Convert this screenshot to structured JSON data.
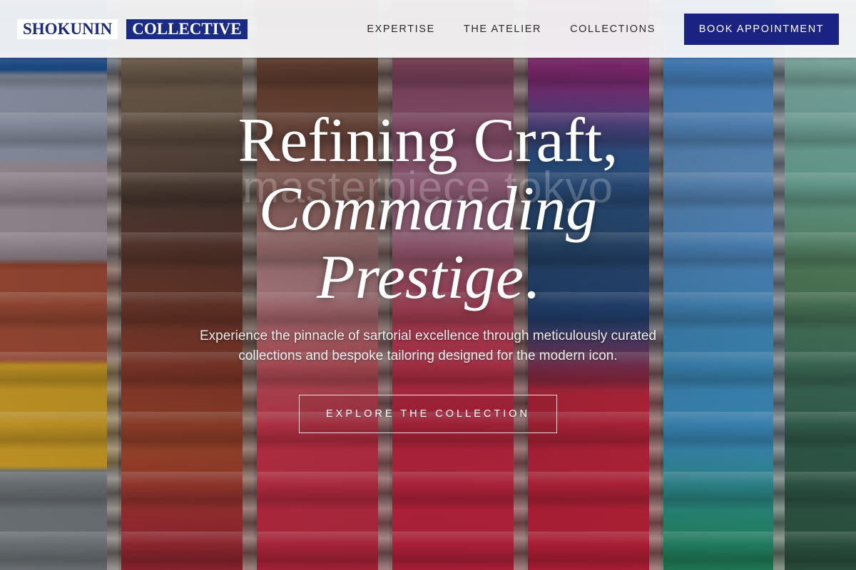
{
  "brand": {
    "name_part_a": "SHOKUNIN",
    "name_part_b": "COLLECTIVE"
  },
  "nav": {
    "links": [
      "EXPERTISE",
      "THE ATELIER",
      "COLLECTIONS"
    ],
    "cta_label": "BOOK APPOINTMENT"
  },
  "hero": {
    "headline_line_1": "Refining Craft,",
    "headline_line_2": "Commanding",
    "headline_line_3_em": "Prestige",
    "headline_line_3_end": ".",
    "watermark": "masterpiece tokyo",
    "subtitle": "Experience the pinnacle of sartorial excellence through meticulously curated collections and bespoke tailoring designed for the modern icon.",
    "cta_label": "EXPLORE THE COLLECTION"
  },
  "colors": {
    "brand_navy": "#1b2382",
    "nav_background": "#f7f7f8",
    "hero_text": "#ffffff"
  }
}
